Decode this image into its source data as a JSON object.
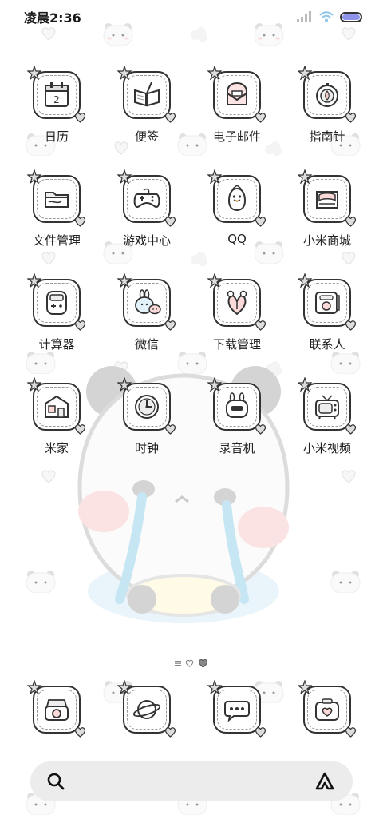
{
  "status_bar": {
    "time": "凌晨2:36",
    "battery_level": 1.0,
    "battery_color": "#8c93e8",
    "icons": [
      "signal-icon",
      "wifi-icon",
      "battery-icon"
    ]
  },
  "apps": [
    {
      "label": "日历",
      "icon": "calendar-icon",
      "glyph_text": "2"
    },
    {
      "label": "便签",
      "icon": "notebook-icon"
    },
    {
      "label": "电子邮件",
      "icon": "mail-icon"
    },
    {
      "label": "指南针",
      "icon": "compass-icon"
    },
    {
      "label": "文件管理",
      "icon": "folder-icon"
    },
    {
      "label": "游戏中心",
      "icon": "gamepad-icon"
    },
    {
      "label": "QQ",
      "icon": "penguin-icon"
    },
    {
      "label": "小米商城",
      "icon": "shop-icon"
    },
    {
      "label": "计算器",
      "icon": "calculator-icon"
    },
    {
      "label": "微信",
      "icon": "chat-bunny-icon"
    },
    {
      "label": "下载管理",
      "icon": "download-icon"
    },
    {
      "label": "联系人",
      "icon": "contacts-icon"
    },
    {
      "label": "米家",
      "icon": "house-icon"
    },
    {
      "label": "时钟",
      "icon": "clock-icon"
    },
    {
      "label": "录音机",
      "icon": "recorder-icon"
    },
    {
      "label": "小米视频",
      "icon": "tv-icon"
    }
  ],
  "dock": [
    {
      "icon": "camera-icon"
    },
    {
      "icon": "browser-planet-icon"
    },
    {
      "icon": "message-bubble-icon"
    },
    {
      "icon": "gallery-camera-icon"
    }
  ],
  "page_indicator": {
    "pages": 3,
    "current": 1
  },
  "search": {
    "icons": [
      "search-icon",
      "assistant-icon"
    ]
  },
  "colors": {
    "icon_border": "#333333",
    "search_bg": "#ececec",
    "cheek_pink": "#f7c6c7",
    "tear_blue": "#bfe3f2"
  }
}
